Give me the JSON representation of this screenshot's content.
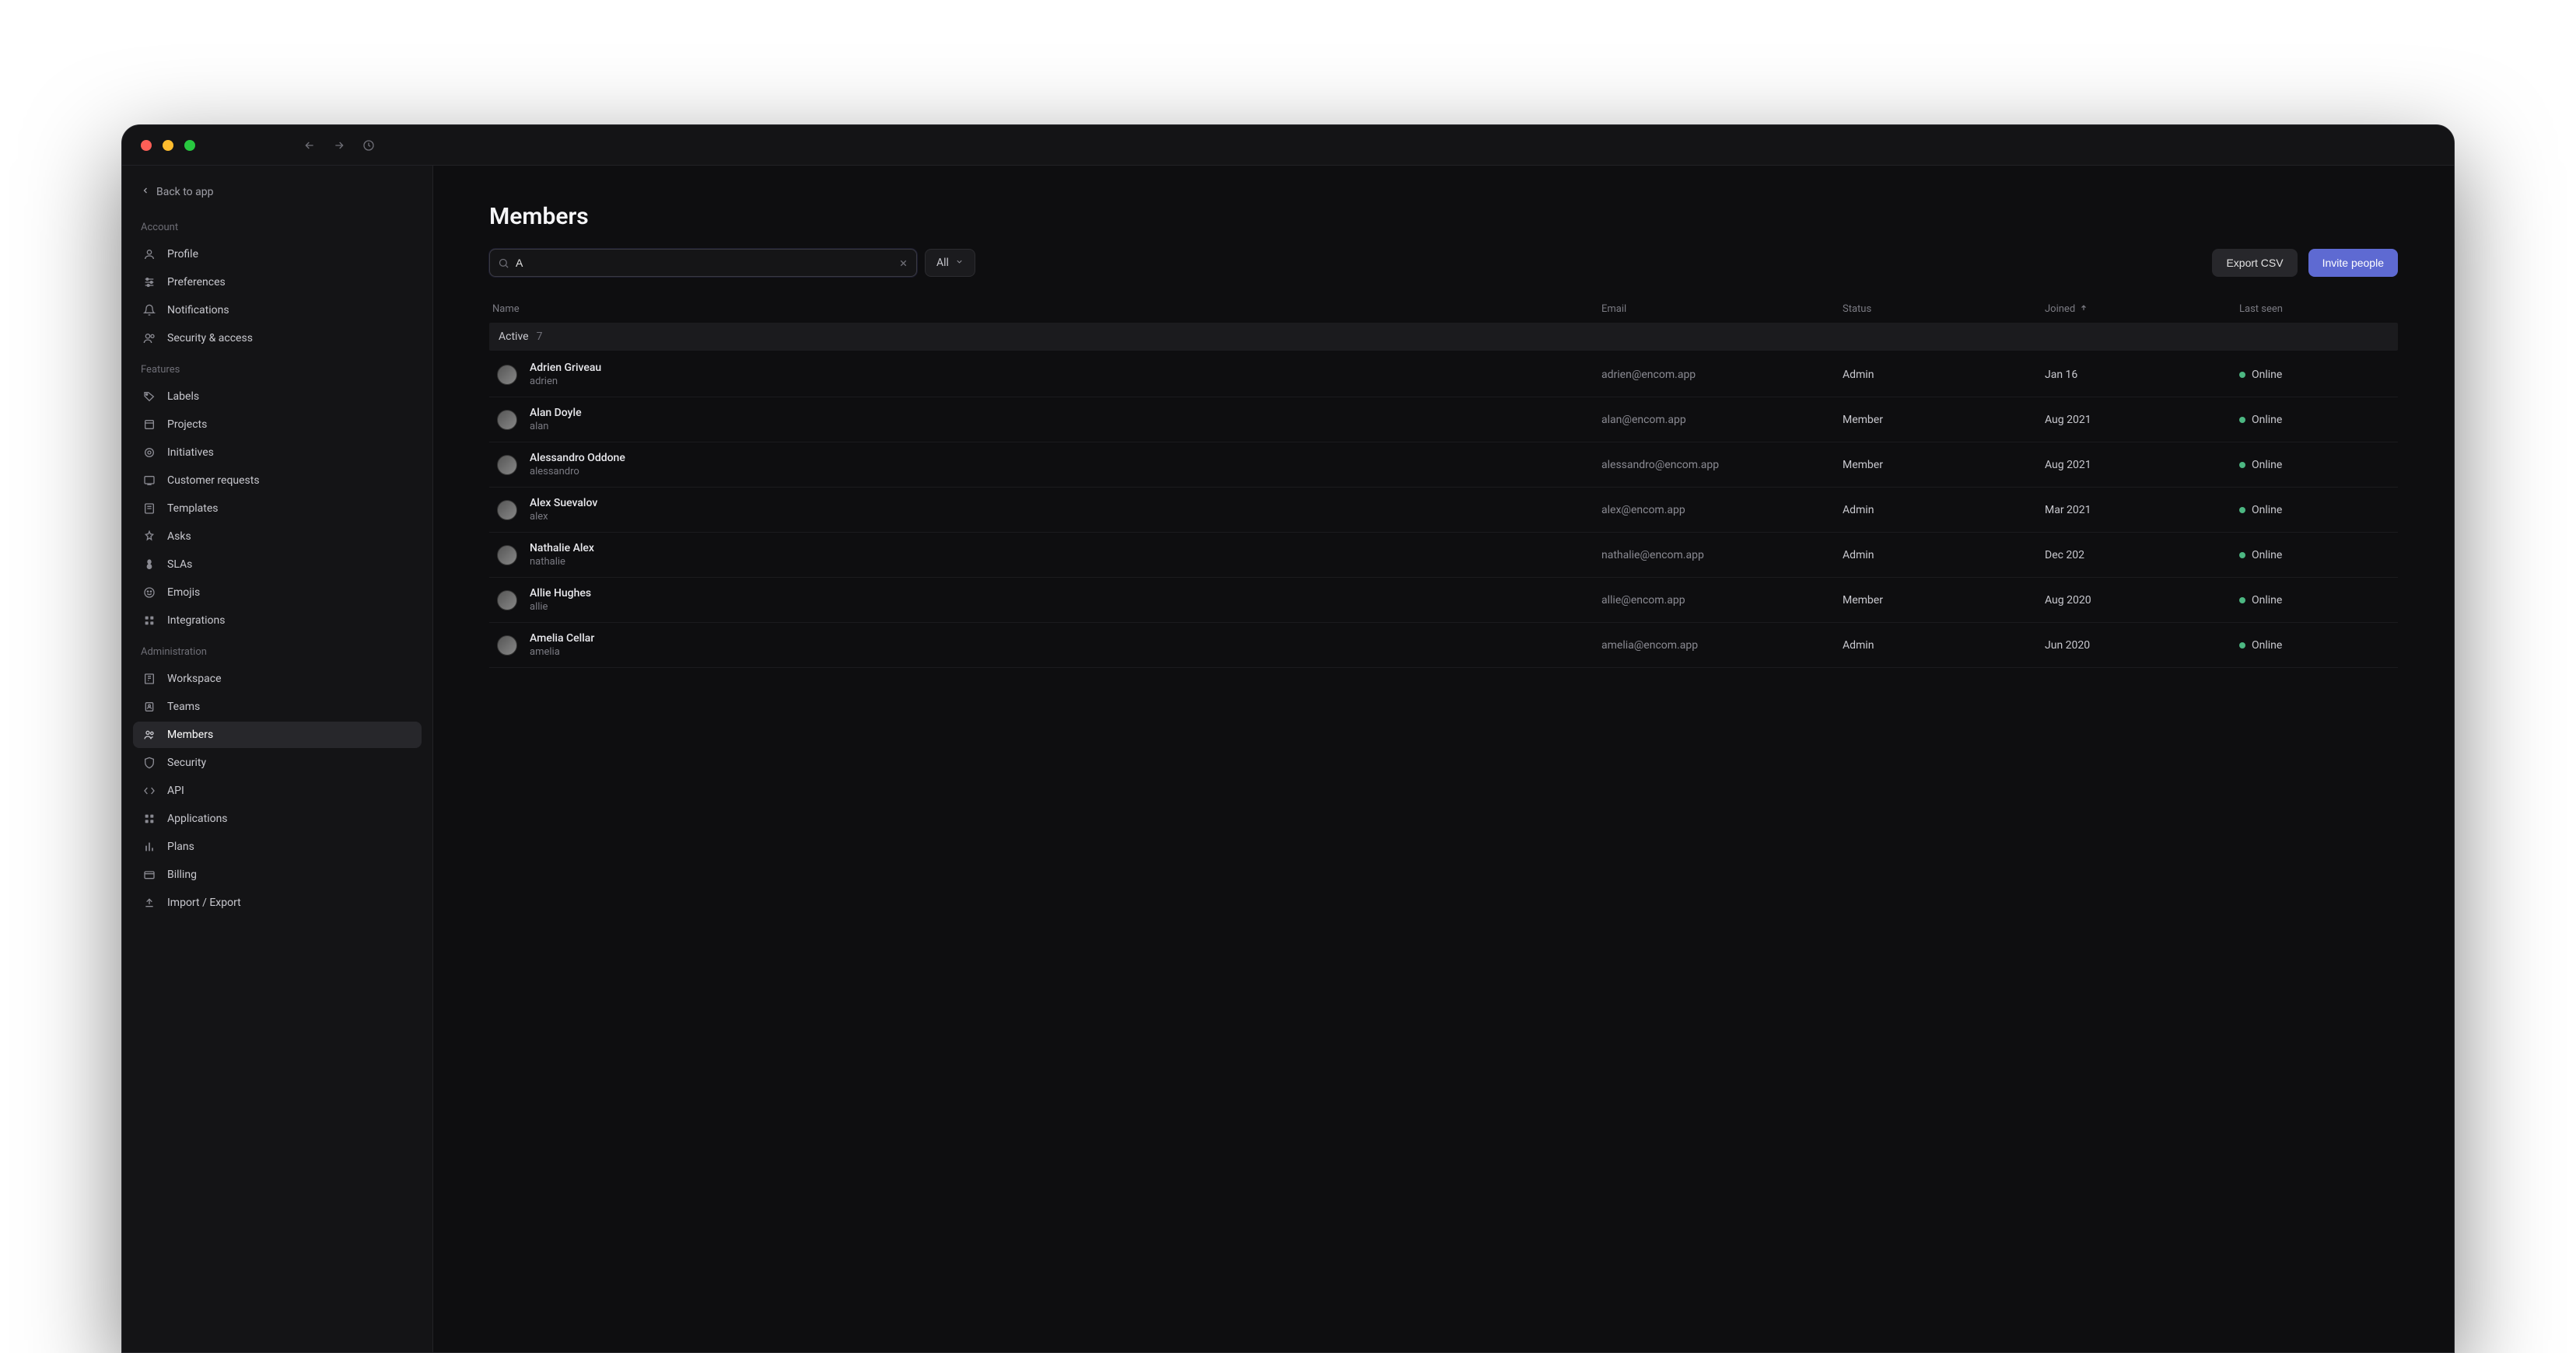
{
  "titlebar": {
    "traffic": [
      "close",
      "minimize",
      "zoom"
    ]
  },
  "sidebar": {
    "back_label": "Back to app",
    "sections": [
      {
        "label": "Account",
        "items": [
          {
            "id": "profile",
            "label": "Profile"
          },
          {
            "id": "preferences",
            "label": "Preferences"
          },
          {
            "id": "notifications",
            "label": "Notifications"
          },
          {
            "id": "security-access",
            "label": "Security & access"
          }
        ]
      },
      {
        "label": "Features",
        "items": [
          {
            "id": "labels",
            "label": "Labels"
          },
          {
            "id": "projects",
            "label": "Projects"
          },
          {
            "id": "initiatives",
            "label": "Initiatives"
          },
          {
            "id": "customer-requests",
            "label": "Customer requests"
          },
          {
            "id": "templates",
            "label": "Templates"
          },
          {
            "id": "asks",
            "label": "Asks"
          },
          {
            "id": "slas",
            "label": "SLAs"
          },
          {
            "id": "emojis",
            "label": "Emojis"
          },
          {
            "id": "integrations",
            "label": "Integrations"
          }
        ]
      },
      {
        "label": "Administration",
        "items": [
          {
            "id": "workspace",
            "label": "Workspace"
          },
          {
            "id": "teams",
            "label": "Teams"
          },
          {
            "id": "members",
            "label": "Members",
            "active": true
          },
          {
            "id": "security",
            "label": "Security"
          },
          {
            "id": "api",
            "label": "API"
          },
          {
            "id": "applications",
            "label": "Applications"
          },
          {
            "id": "plans",
            "label": "Plans"
          },
          {
            "id": "billing",
            "label": "Billing"
          },
          {
            "id": "import-export",
            "label": "Import / Export"
          }
        ]
      }
    ]
  },
  "page": {
    "title": "Members",
    "search_value": "A",
    "filter_label": "All",
    "export_label": "Export CSV",
    "invite_label": "Invite people"
  },
  "table": {
    "columns": {
      "name": "Name",
      "email": "Email",
      "status": "Status",
      "joined": "Joined",
      "last_seen": "Last seen"
    },
    "group": {
      "label": "Active",
      "count": "7"
    },
    "rows": [
      {
        "name": "Adrien Griveau",
        "username": "adrien",
        "email": "adrien@encom.app",
        "status": "Admin",
        "joined": "Jan 16",
        "seen": "Online"
      },
      {
        "name": "Alan Doyle",
        "username": "alan",
        "email": "alan@encom.app",
        "status": "Member",
        "joined": "Aug 2021",
        "seen": "Online"
      },
      {
        "name": "Alessandro Oddone",
        "username": "alessandro",
        "email": "alessandro@encom.app",
        "status": "Member",
        "joined": "Aug 2021",
        "seen": "Online"
      },
      {
        "name": "Alex Suevalov",
        "username": "alex",
        "email": "alex@encom.app",
        "status": "Admin",
        "joined": "Mar 2021",
        "seen": "Online"
      },
      {
        "name": "Nathalie Alex",
        "username": "nathalie",
        "email": "nathalie@encom.app",
        "status": "Admin",
        "joined": "Dec 202",
        "seen": "Online"
      },
      {
        "name": "Allie Hughes",
        "username": "allie",
        "email": "allie@encom.app",
        "status": "Member",
        "joined": "Aug 2020",
        "seen": "Online"
      },
      {
        "name": "Amelia Cellar",
        "username": "amelia",
        "email": "amelia@encom.app",
        "status": "Admin",
        "joined": "Jun 2020",
        "seen": "Online"
      }
    ]
  }
}
